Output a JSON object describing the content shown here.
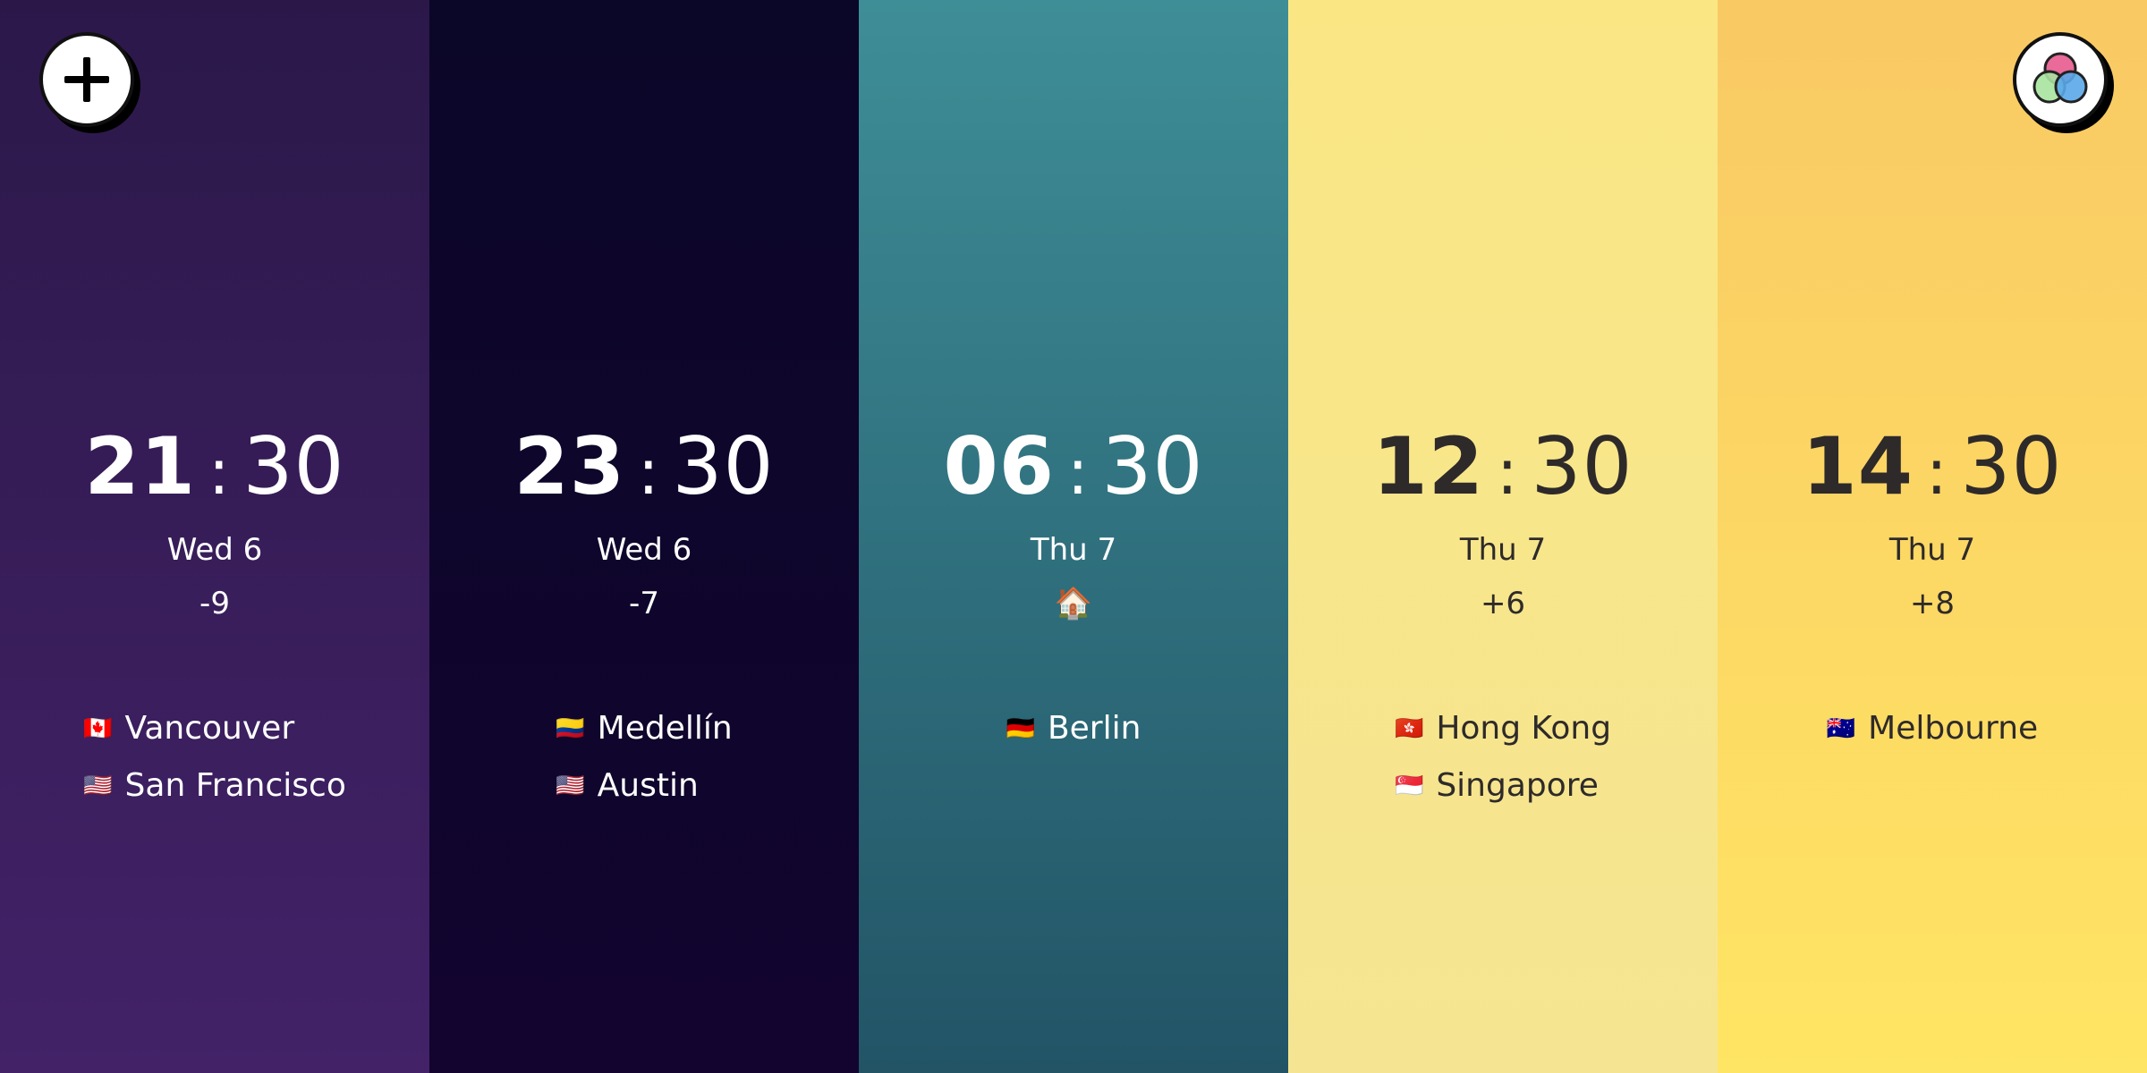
{
  "zones": [
    {
      "hour": "21",
      "minute": "30",
      "date": "Wed 6",
      "offset": "-9",
      "cities": [
        {
          "flag": "🇨🇦",
          "name": "Vancouver"
        },
        {
          "flag": "🇺🇸",
          "name": "San Francisco"
        }
      ]
    },
    {
      "hour": "23",
      "minute": "30",
      "date": "Wed 6",
      "offset": "-7",
      "cities": [
        {
          "flag": "🇨🇴",
          "name": "Medellín"
        },
        {
          "flag": "🇺🇸",
          "name": "Austin"
        }
      ]
    },
    {
      "hour": "06",
      "minute": "30",
      "date": "Thu 7",
      "offset": "🏠",
      "cities": [
        {
          "flag": "🇩🇪",
          "name": "Berlin"
        }
      ]
    },
    {
      "hour": "12",
      "minute": "30",
      "date": "Thu 7",
      "offset": "+6",
      "cities": [
        {
          "flag": "🇭🇰",
          "name": "Hong Kong"
        },
        {
          "flag": "🇸🇬",
          "name": "Singapore"
        }
      ]
    },
    {
      "hour": "14",
      "minute": "30",
      "date": "Thu 7",
      "offset": "+8",
      "cities": [
        {
          "flag": "🇦🇺",
          "name": "Melbourne"
        }
      ]
    }
  ],
  "separator": ":",
  "buttons": {
    "add_icon": "plus-icon",
    "theme_icon": "color-circles-icon"
  },
  "colors": {
    "col1": "#432268",
    "col2": "#0b0729",
    "col3": "#3e8e97",
    "col4": "#fae683",
    "col5": "#ffe564",
    "dark_text": "#2e2a2a",
    "light_text": "#ffffff"
  }
}
